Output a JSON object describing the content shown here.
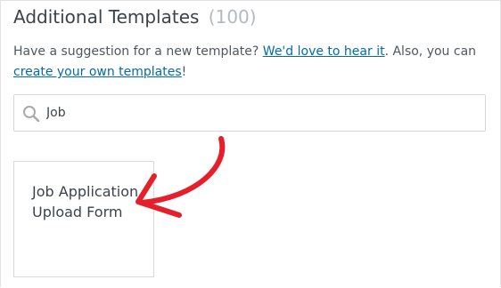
{
  "header": {
    "title": "Additional Templates",
    "count": "(100)"
  },
  "intro": {
    "text_before": "Have a suggestion for a new template? ",
    "suggest_link": "We'd love to hear it",
    "text_middle": ". Also, you can ",
    "create_link": "create your own templates",
    "text_after": "!"
  },
  "search": {
    "icon": "search-icon",
    "value": "Job",
    "placeholder": ""
  },
  "templates": [
    {
      "title": "Job Application Upload Form"
    }
  ],
  "annotation": {
    "icon": "curved-arrow-icon",
    "color": "#e5202a"
  },
  "colors": {
    "link": "#036aab",
    "title": "#3c434a",
    "count": "#b4b9be",
    "border": "#d9d9d9"
  }
}
